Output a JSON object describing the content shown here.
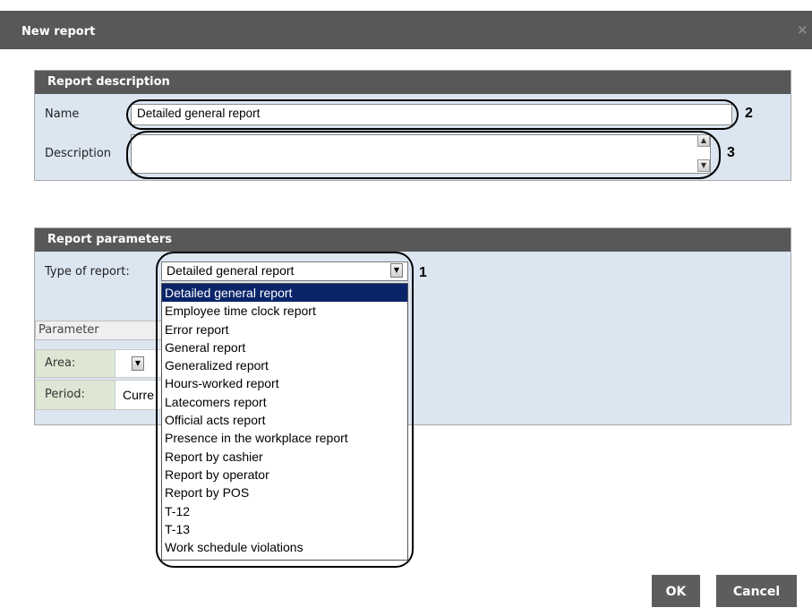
{
  "dialog": {
    "title": "New report",
    "close_glyph": "×"
  },
  "report_description": {
    "header": "Report description",
    "name_label": "Name",
    "name_value": "Detailed general report",
    "description_label": "Description",
    "description_value": ""
  },
  "report_parameters": {
    "header": "Report parameters",
    "type_label": "Type of report:",
    "type_selected": "Detailed general report",
    "options": [
      "Detailed general report",
      "Employee time clock report",
      "Error report",
      "General report",
      "Generalized report",
      "Hours-worked report",
      "Latecomers report",
      "Official acts report",
      "Presence in the workplace report",
      "Report by cashier",
      "Report by operator",
      "Report by POS",
      "T-12",
      "T-13",
      "Work schedule violations"
    ],
    "param_table": {
      "column_header": "Parameter",
      "area_label": "Area:",
      "period_label": "Period:",
      "period_value_partial": "Curre"
    }
  },
  "callouts": {
    "one": "1",
    "two": "2",
    "three": "3"
  },
  "buttons": {
    "ok": "OK",
    "cancel": "Cancel"
  },
  "icons": {
    "close": "close-icon",
    "dropdown": "chevron-down-icon",
    "scroll_up": "scroll-up-icon",
    "scroll_down": "scroll-down-icon"
  }
}
